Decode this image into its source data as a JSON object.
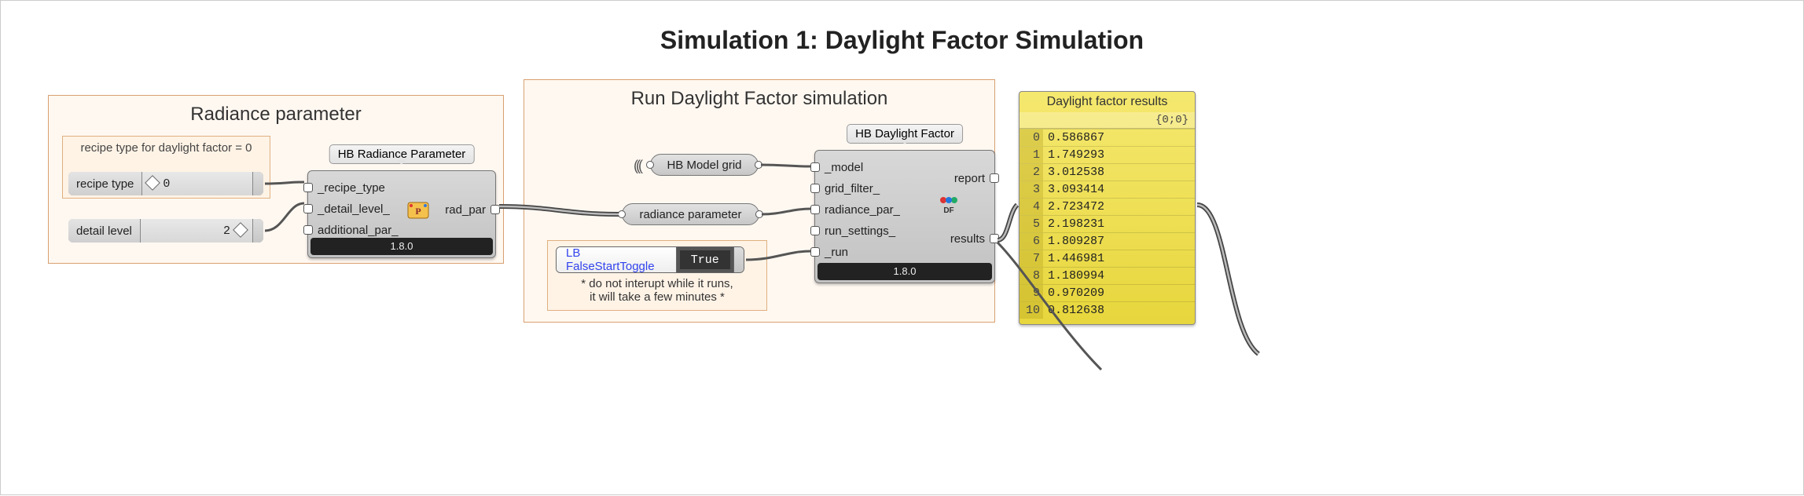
{
  "page_title": "Simulation 1: Daylight Factor Simulation",
  "groups": {
    "radiance": {
      "title": "Radiance parameter"
    },
    "run": {
      "title": "Run Daylight Factor simulation"
    }
  },
  "recipe_hint": "recipe type for daylight factor = 0",
  "sliders": {
    "recipe": {
      "label": "recipe type",
      "value": "0"
    },
    "detail": {
      "label": "detail level",
      "value": "2"
    }
  },
  "rad_param_node": {
    "tag": "HB Radiance Parameter",
    "inputs": [
      "_recipe_type",
      "_detail_level_",
      "additional_par_"
    ],
    "outputs": [
      "rad_par"
    ],
    "version": "1.8.0",
    "icon_name": "hb-radiance-icon"
  },
  "relays": {
    "model_grid": "HB Model grid",
    "radiance_param": "radiance parameter"
  },
  "toggle": {
    "label": "LB FalseStartToggle",
    "value": "True"
  },
  "toggle_note_line1": "* do not interupt while it runs,",
  "toggle_note_line2": "it will take a few minutes *",
  "df_node": {
    "tag": "HB Daylight Factor",
    "inputs": [
      "_model",
      "grid_filter_",
      "radiance_par_",
      "run_settings_",
      "_run"
    ],
    "outputs": [
      "report",
      "results"
    ],
    "version": "1.8.0",
    "icon_name": "hb-df-icon"
  },
  "results": {
    "title": "Daylight factor results",
    "header": "{0;0}",
    "rows": [
      {
        "i": "0",
        "v": "0.586867"
      },
      {
        "i": "1",
        "v": "1.749293"
      },
      {
        "i": "2",
        "v": "3.012538"
      },
      {
        "i": "3",
        "v": "3.093414"
      },
      {
        "i": "4",
        "v": "2.723472"
      },
      {
        "i": "5",
        "v": "2.198231"
      },
      {
        "i": "6",
        "v": "1.809287"
      },
      {
        "i": "7",
        "v": "1.446981"
      },
      {
        "i": "8",
        "v": "1.180994"
      },
      {
        "i": "9",
        "v": "0.970209"
      },
      {
        "i": "10",
        "v": "0.812638"
      }
    ]
  }
}
